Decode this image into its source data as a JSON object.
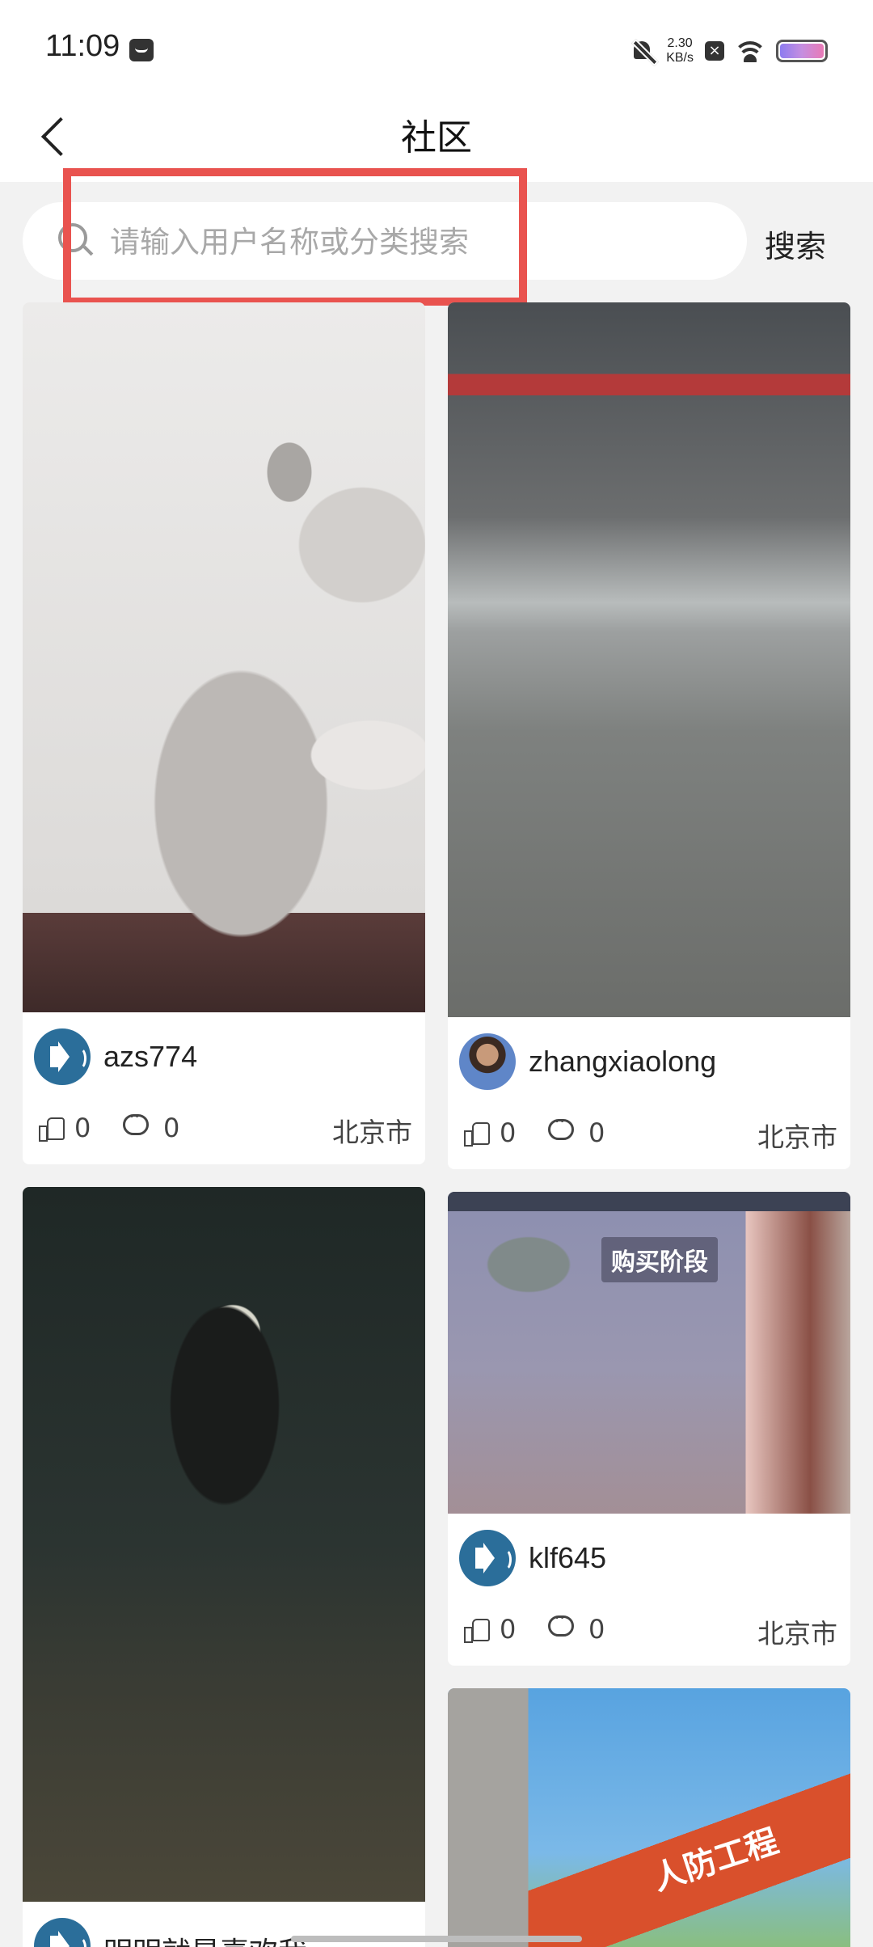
{
  "status_bar": {
    "time": "11:09",
    "net_speed_value": "2.30",
    "net_speed_unit": "KB/s",
    "x_badge": "×"
  },
  "header": {
    "title": "社区"
  },
  "search": {
    "placeholder": "请输入用户名称或分类搜索",
    "button_label": "搜索"
  },
  "posts": [
    {
      "username": "azs774",
      "likes": "0",
      "comments": "0",
      "location": "北京市",
      "avatar": "speaker-icon",
      "image": "cat photo"
    },
    {
      "username": "zhangxiaolong",
      "likes": "0",
      "comments": "0",
      "location": "北京市",
      "avatar": "user-photo",
      "image": "factory photo"
    },
    {
      "username": "klf645",
      "likes": "0",
      "comments": "0",
      "location": "北京市",
      "avatar": "speaker-icon",
      "image": "game screenshot",
      "image_text": "购买阶段"
    },
    {
      "username": "明明就是喜欢我",
      "avatar": "speaker-icon",
      "image": "shoe photo"
    },
    {
      "image": "building sign photo",
      "image_text": "人防工程"
    }
  ],
  "colors": {
    "highlight": "#e9534f",
    "avatar_blue": "#2b6e9a",
    "background": "#f2f2f2"
  }
}
